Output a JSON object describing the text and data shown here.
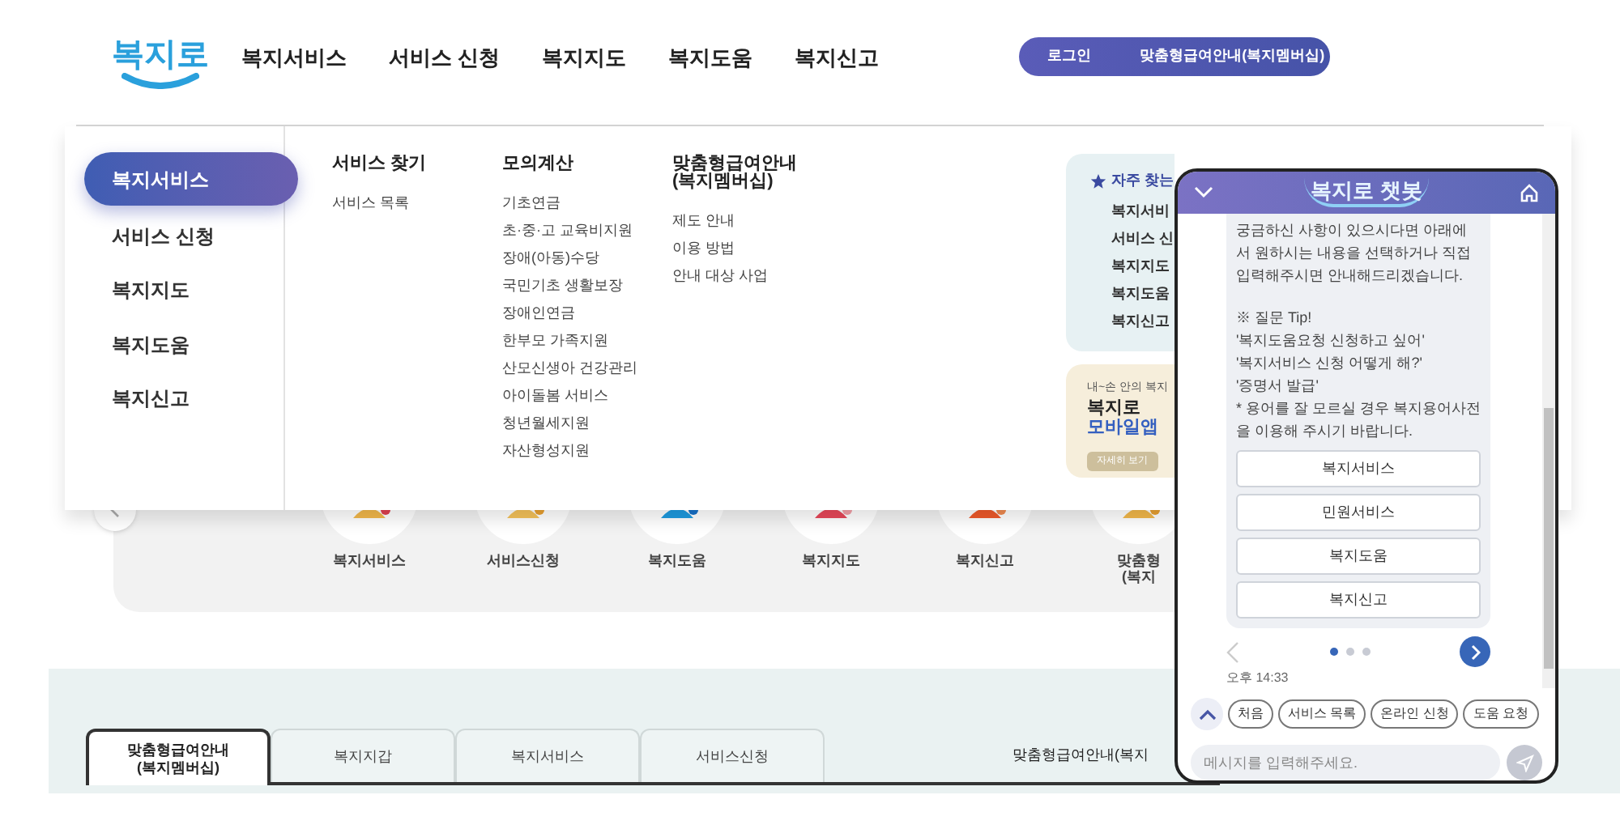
{
  "header": {
    "logo": "복지로",
    "nav": [
      "복지서비스",
      "서비스 신청",
      "복지지도",
      "복지도움",
      "복지신고"
    ],
    "login": "로그인",
    "membership": "맞춤형급여안내(복지멤버십)"
  },
  "mega_menu": {
    "sidebar": [
      {
        "label": "복지서비스",
        "selected": true
      },
      {
        "label": "서비스 신청",
        "selected": false
      },
      {
        "label": "복지지도",
        "selected": false
      },
      {
        "label": "복지도움",
        "selected": false
      },
      {
        "label": "복지신고",
        "selected": false
      }
    ],
    "columns": [
      {
        "title": [
          "서비스 찾기"
        ],
        "items": [
          "서비스 목록"
        ]
      },
      {
        "title": [
          "모의계산"
        ],
        "items": [
          "기초연금",
          "초·중·고 교육비지원",
          "장애(아동)수당",
          "국민기초 생활보장",
          "장애인연금",
          "한부모 가족지원",
          "산모신생아 건강관리",
          "아이돌봄 서비스",
          "청년월세지원",
          "자산형성지원"
        ]
      },
      {
        "title": [
          "맞춤형급여안내",
          "(복지멤버십)"
        ],
        "items": [
          "제도 안내",
          "이용 방법",
          "안내 대상 사업"
        ]
      }
    ],
    "favorites": {
      "title": "자주 찾는",
      "items": [
        "복지서비",
        "서비스 신",
        "복지지도",
        "복지도움",
        "복지신고"
      ]
    },
    "app_banner": {
      "tagline": "내~손 안의 복지",
      "name": "복지로",
      "highlight": "모바일앱",
      "button": "자세히 보기"
    }
  },
  "quick_services": {
    "items": [
      {
        "label": [
          "복지서비스"
        ]
      },
      {
        "label": [
          "서비스신청"
        ]
      },
      {
        "label": [
          "복지도움"
        ]
      },
      {
        "label": [
          "복지지도"
        ]
      },
      {
        "label": [
          "복지신고"
        ]
      },
      {
        "label": [
          "맞춤형",
          "(복지"
        ]
      }
    ]
  },
  "tabs": [
    {
      "label": [
        "맞춤형급여안내",
        "(복지멤버십)"
      ],
      "selected": true
    },
    {
      "label": [
        "복지지갑"
      ],
      "selected": false
    },
    {
      "label": [
        "복지서비스"
      ],
      "selected": false
    },
    {
      "label": [
        "서비스신청"
      ],
      "selected": false
    }
  ],
  "tabs_side_label": "맞춤형급여안내(복지",
  "chatbot": {
    "title": "복지로 챗봇",
    "message": "궁금하신 사항이 있으시다면 아래에서 원하시는 내용을 선택하거나 직접 입력해주시면 안내해드리겠습니다.",
    "tips": [
      "※ 질문 Tip!",
      "'복지도움요청 신청하고 싶어'",
      "'복지서비스 신청 어떻게 해?'",
      "'증명서 발급'",
      "* 용어를 잘 모르실 경우 복지용어사전을 이용해 주시기 바랍니다."
    ],
    "options": [
      "복지서비스",
      "민원서비스",
      "복지도움",
      "복지신고"
    ],
    "pages": [
      {
        "selected": true
      },
      {
        "selected": false
      },
      {
        "selected": false
      }
    ],
    "time": "오후 14:33",
    "chips": [
      "처음",
      "서비스 목록",
      "온라인 신청",
      "도움 요청"
    ],
    "input": {
      "placeholder": "메시지를 입력해주세요."
    }
  }
}
